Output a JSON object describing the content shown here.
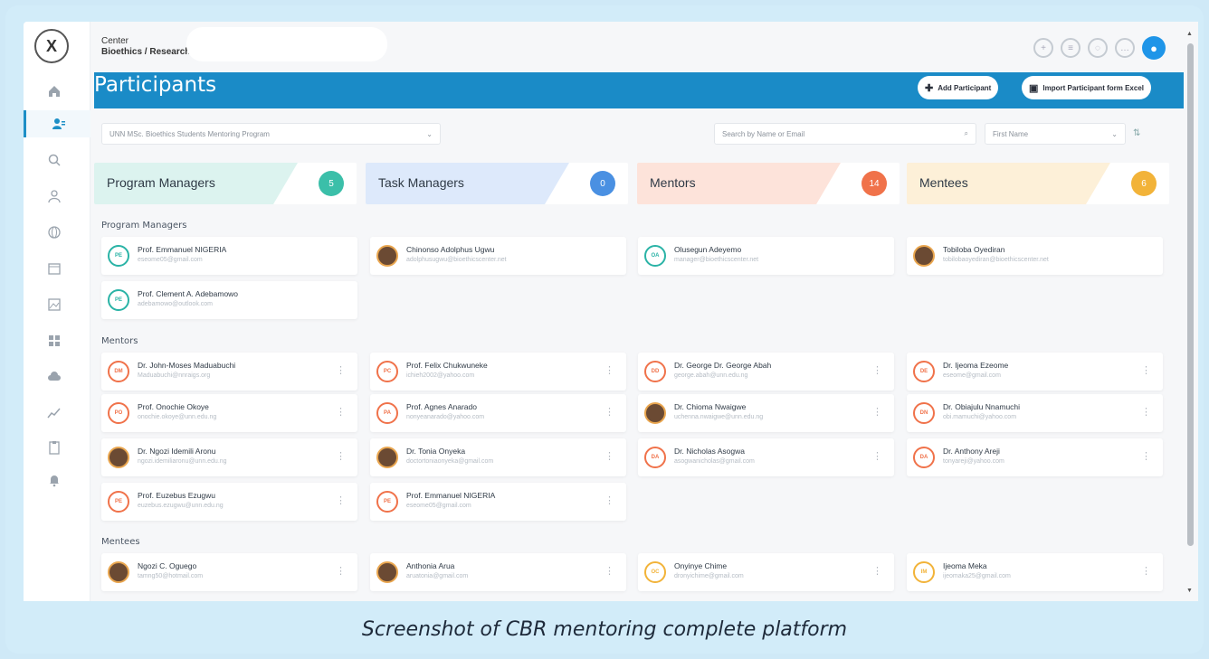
{
  "brand": {
    "line1": "Center",
    "line2": "Bioethics / Research"
  },
  "page_title": "Participants",
  "buttons": {
    "add": "Add Participant",
    "import": "Import Participant form Excel"
  },
  "filters": {
    "program": "UNN MSc. Bioethics Students Mentoring Program",
    "search_placeholder": "Search by Name or Email",
    "sort": "First Name"
  },
  "stats": [
    {
      "label": "Program Managers",
      "count": "5",
      "color": "#3bbfa9",
      "bg": "#dcf3ef"
    },
    {
      "label": "Task Managers",
      "count": "0",
      "color": "#4a90e2",
      "bg": "#dde9fb"
    },
    {
      "label": "Mentors",
      "count": "14",
      "color": "#f0724a",
      "bg": "#fde3da"
    },
    {
      "label": "Mentees",
      "count": "6",
      "color": "#f2b339",
      "bg": "#fdf0d8"
    }
  ],
  "sections": {
    "managers": "Program Managers",
    "mentors": "Mentors",
    "mentees": "Mentees"
  },
  "managers": [
    {
      "initials": "PE",
      "name": "Prof. Emmanuel NIGERIA",
      "email": "eseome05@gmail.com",
      "photo": false
    },
    {
      "initials": "",
      "name": "Chinonso Adolphus Ugwu",
      "email": "adolphusugwu@bioethicscenter.net",
      "photo": true
    },
    {
      "initials": "OA",
      "name": "Olusegun Adeyemo",
      "email": "manager@bioethicscenter.net",
      "photo": false
    },
    {
      "initials": "",
      "name": "Tobiloba Oyediran",
      "email": "tobilobaoyediran@bioethicscenter.net",
      "photo": true
    },
    {
      "initials": "PE",
      "name": "Prof. Clement A. Adebamowo",
      "email": "adebamowo@outlook.com",
      "photo": false
    }
  ],
  "mentors": [
    {
      "initials": "DM",
      "name": "Dr. John-Moses Maduabuchi",
      "email": "Maduabuchi@nnraigs.org",
      "photo": false
    },
    {
      "initials": "PC",
      "name": "Prof. Felix Chukwuneke",
      "email": "ichieh2002@yahoo.com",
      "photo": false
    },
    {
      "initials": "DD",
      "name": "Dr. George Dr. George Abah",
      "email": "george.abah@unn.edu.ng",
      "photo": false
    },
    {
      "initials": "DE",
      "name": "Dr. Ijeoma Ezeome",
      "email": "eseome@gmail.com",
      "photo": false
    },
    {
      "initials": "PO",
      "name": "Prof. Onochie Okoye",
      "email": "onochie.okoye@unn.edu.ng",
      "photo": false
    },
    {
      "initials": "PA",
      "name": "Prof. Agnes Anarado",
      "email": "nonyeanarado@yahoo.com",
      "photo": false
    },
    {
      "initials": "",
      "name": "Dr. Chioma Nwaigwe",
      "email": "uchenna.nwaigwe@unn.edu.ng",
      "photo": true
    },
    {
      "initials": "DN",
      "name": "Dr. Obiajulu Nnamuchi",
      "email": "obi.mamuchi@yahoo.com",
      "photo": false
    },
    {
      "initials": "",
      "name": "Dr. Ngozi Idemili Aronu",
      "email": "ngozi.idemiliaronu@unn.edu.ng",
      "photo": true
    },
    {
      "initials": "",
      "name": "Dr. Tonia Onyeka",
      "email": "doctortoniaonyeka@gmail.com",
      "photo": true
    },
    {
      "initials": "DA",
      "name": "Dr. Nicholas Asogwa",
      "email": "asogwanicholas@gmail.com",
      "photo": false
    },
    {
      "initials": "DA",
      "name": "Dr. Anthony Areji",
      "email": "tonyareji@yahoo.com",
      "photo": false
    },
    {
      "initials": "PE",
      "name": "Prof. Euzebus Ezugwu",
      "email": "euzebus.ezugwu@unn.edu.ng",
      "photo": false
    },
    {
      "initials": "PE",
      "name": "Prof. Emmanuel NIGERIA",
      "email": "eseome05@gmail.com",
      "photo": false
    }
  ],
  "mentees": [
    {
      "initials": "",
      "name": "Ngozi C. Oguego",
      "email": "tamng50@hotmail.com",
      "photo": true
    },
    {
      "initials": "",
      "name": "Anthonia Arua",
      "email": "aruatonia@gmail.com",
      "photo": true
    },
    {
      "initials": "OC",
      "name": "Onyinye Chime",
      "email": "dronyichime@gmail.com",
      "photo": false
    },
    {
      "initials": "IM",
      "name": "Ijeoma Meka",
      "email": "ijeomaka25@gmail.com",
      "photo": false
    }
  ],
  "caption": "Screenshot of CBR mentoring complete platform",
  "nav_icons": [
    "home-icon",
    "participants-icon",
    "search-icon",
    "user-icon",
    "globe-icon",
    "calendar-icon",
    "gallery-icon",
    "grid-icon",
    "cloud-icon",
    "chart-icon",
    "clipboard-icon",
    "bell-icon"
  ],
  "top_icons": [
    "plus-circle-icon",
    "message-icon",
    "bell-circle-icon",
    "chat-icon",
    "profile-icon"
  ]
}
